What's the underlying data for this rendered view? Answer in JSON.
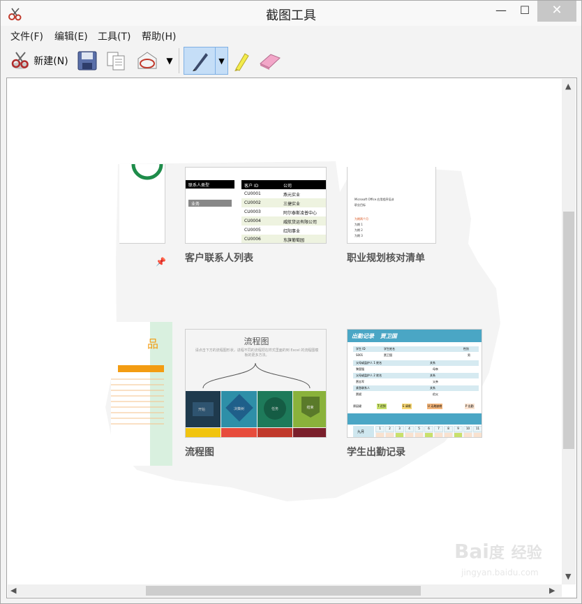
{
  "window": {
    "title": "截图工具",
    "minimize_glyph": "—",
    "maximize_glyph": "☐",
    "close_glyph": "✕"
  },
  "menu": {
    "items": [
      "文件(F)",
      "编辑(E)",
      "工具(T)",
      "帮助(H)"
    ]
  },
  "toolbar": {
    "new_label": "新建(N)",
    "icons": [
      "scissors-icon",
      "save-icon",
      "copy-icon",
      "send-email-icon",
      "dropdown-icon",
      "pen-icon",
      "highlighter-icon",
      "eraser-icon"
    ]
  },
  "content": {
    "cards": [
      {
        "title": "客户联系人列表"
      },
      {
        "title": "职业规划核对清单"
      },
      {
        "title": "流程图"
      },
      {
        "title": "学生出勤记录"
      }
    ],
    "contact_table": {
      "filter_label": "联系人类型",
      "filter_item": "业务",
      "headers": [
        "客户 ID",
        "公司"
      ],
      "rows": [
        [
          "CU0001",
          "燕元实业"
        ],
        [
          "CU0002",
          "三捷实业"
        ],
        [
          "CU0003",
          "阿尔泰斯凌普中心"
        ],
        [
          "CU0004",
          "威航货运有限公司"
        ],
        [
          "CU0005",
          "红阳事业"
        ],
        [
          "CU0006",
          "东旗葡萄园"
        ]
      ]
    },
    "career_doc": {
      "line1": "Microsoft Office 应用程序培训",
      "line2": "职业目标",
      "highlight": "为期两个月",
      "items": [
        "为期 1",
        "为期 2",
        "为期 3"
      ]
    },
    "flowchart": {
      "title": "流程图",
      "desc": "请点击下方的流程图形状，进程不同的流程把在样式里面的到 Excel 的流程图模板的更多方法。",
      "tiles": [
        "开始",
        "决策树",
        "任务",
        "结束"
      ]
    },
    "attendance": {
      "title": "出勤记录",
      "name": "贾卫国",
      "student_id_label": "学生 ID",
      "student_name_label": "学生姓名",
      "gender_label": "性别",
      "student_id": "S001",
      "gender_value": "男",
      "guardian1_label": "父母或监护人 1 姓名",
      "guardian1": "黎国强",
      "relation_label": "关系",
      "relation1": "母亲",
      "guardian2_label": "父母或监护人 2 姓名",
      "guardian2": "贾志军",
      "relation2": "父亲",
      "emergency_label": "紧急联系人",
      "emergency": "贾斌",
      "relation3": "伯父",
      "legend": [
        "原因键",
        "T 迟到",
        "E 请假",
        "U 无故缺席",
        "P 出勤"
      ],
      "month": "九月",
      "days": [
        "1",
        "2",
        "3",
        "4",
        "5",
        "6",
        "7",
        "8",
        "9",
        "10",
        "11"
      ]
    }
  },
  "watermark": {
    "logo": "Bai 经验",
    "url": "jingyan.baidu.com"
  },
  "colors": {
    "selected_tool_bg": "#c5def7",
    "attendance_header": "#4aa6c5",
    "contact_header": "#000000"
  }
}
